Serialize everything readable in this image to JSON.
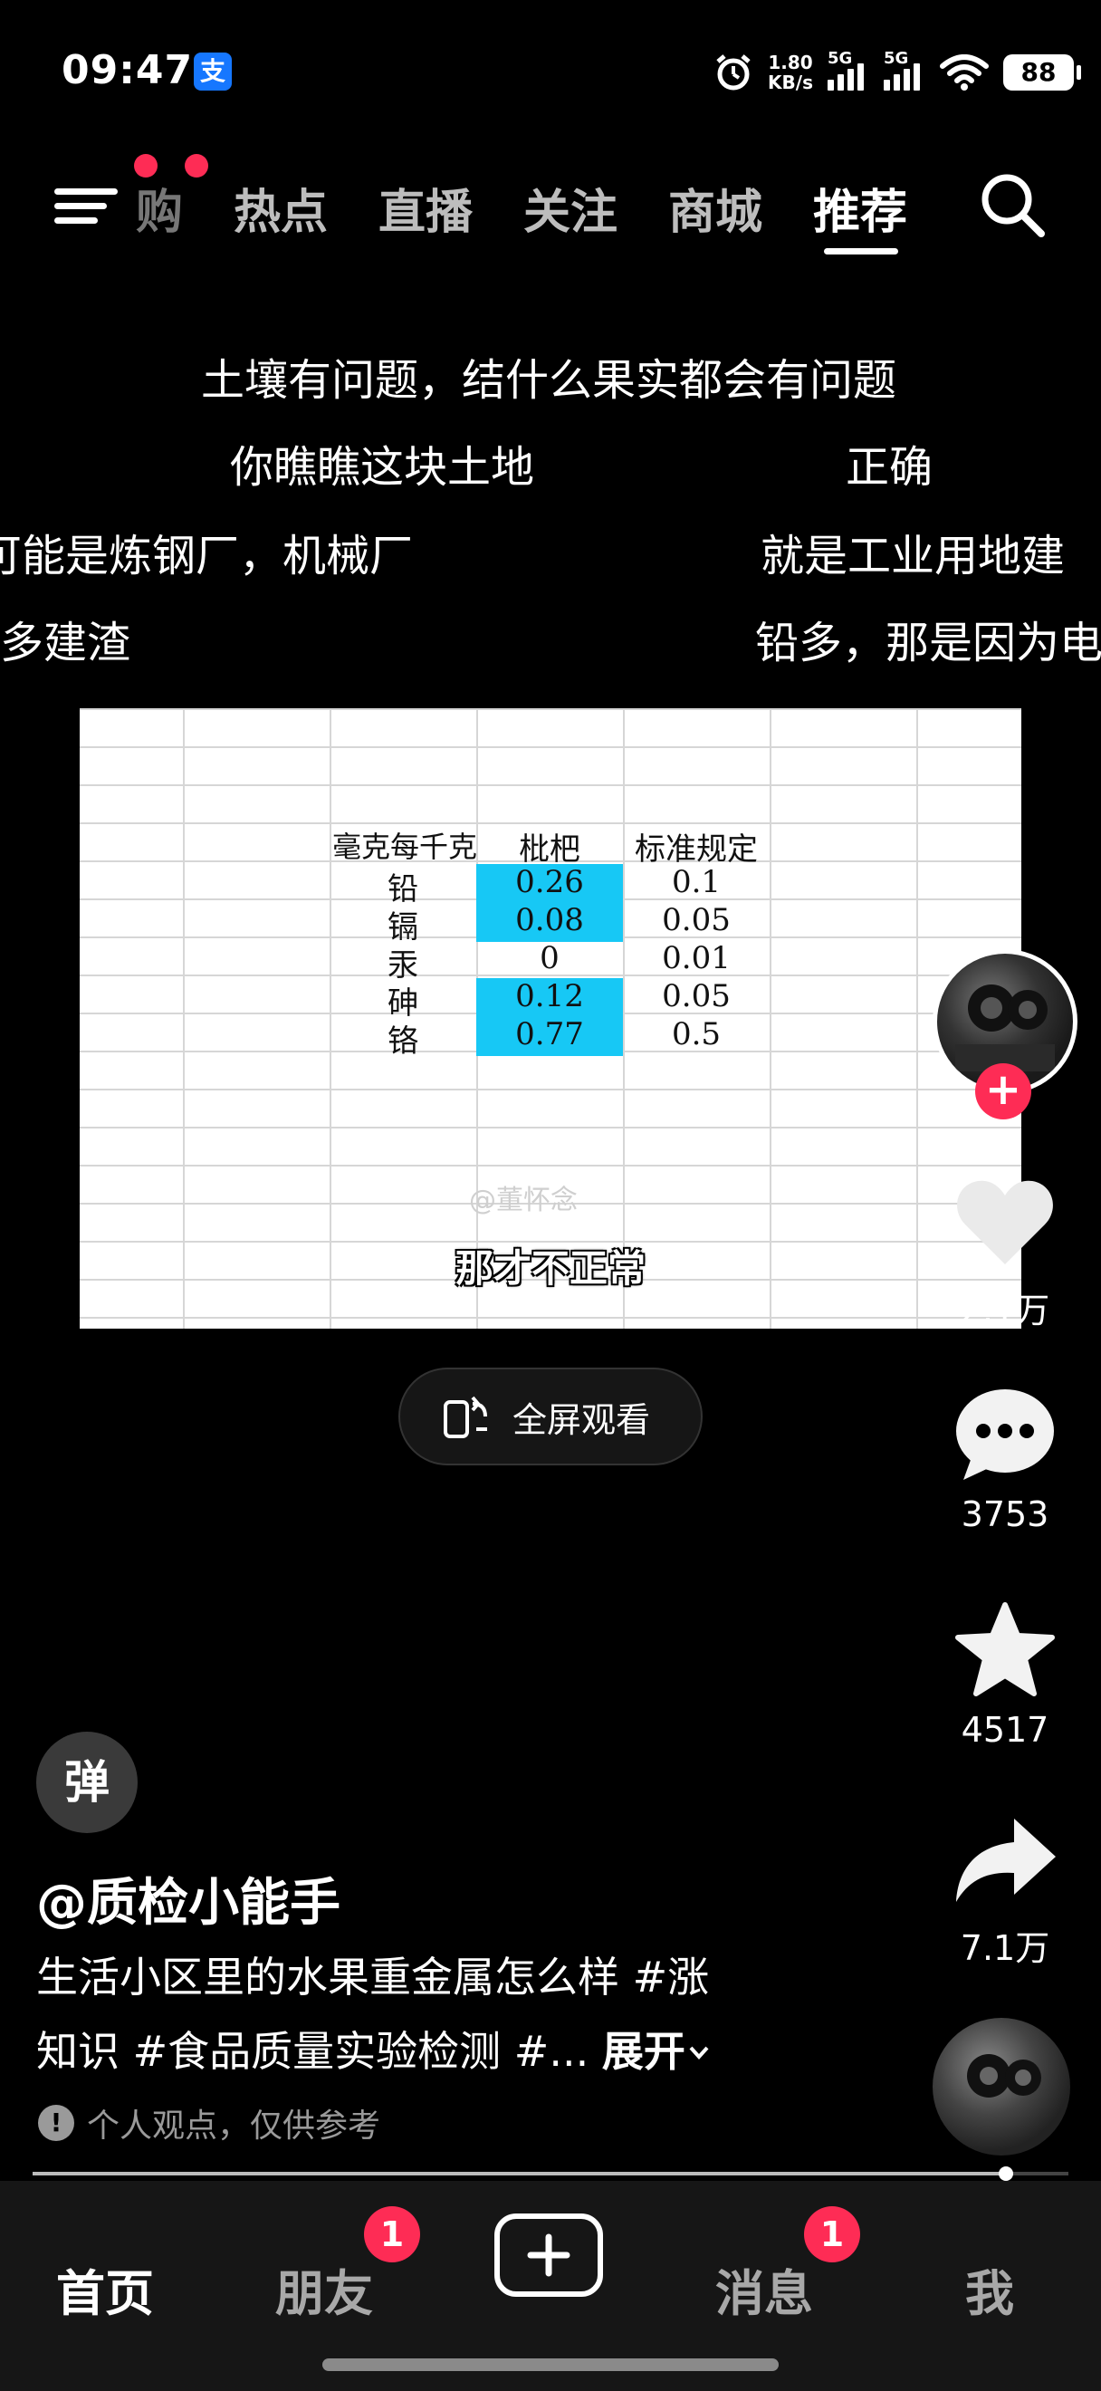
{
  "status_bar": {
    "time": "09:47",
    "app_icon": "alipay-icon",
    "alipay_glyph": "支",
    "net_speed_value": "1.80",
    "net_speed_unit": "KB/s",
    "sim1_label": "5G",
    "sim2_label": "5G",
    "battery": "88"
  },
  "top_nav": {
    "partial_tab": "购",
    "tabs": [
      "热点",
      "直播",
      "关注",
      "商城",
      "推荐"
    ],
    "active_tab": "推荐"
  },
  "lyrics": [
    "土壤有问题，结什么果实都会有问题",
    "你瞧瞧这块土地",
    "正确",
    "可能是炼钢厂，机械厂",
    "就是工业用地建",
    "很多建渣",
    "铅多，那是因为电"
  ],
  "video": {
    "table_header": [
      "毫克每千克",
      "枇杷",
      "标准规定"
    ],
    "rows": [
      {
        "element": "铅",
        "value": "0.26",
        "standard": "0.1",
        "highlight": true
      },
      {
        "element": "镉",
        "value": "0.08",
        "standard": "0.05",
        "highlight": true
      },
      {
        "element": "汞",
        "value": "0",
        "standard": "0.01",
        "highlight": false
      },
      {
        "element": "砷",
        "value": "0.12",
        "standard": "0.05",
        "highlight": true
      },
      {
        "element": "铬",
        "value": "0.77",
        "standard": "0.5",
        "highlight": true
      }
    ],
    "watermark": "@董怀念",
    "subtitle": "那才不正常",
    "highlight_color": "#17c8f5"
  },
  "fullscreen_button": {
    "label": "全屏观看"
  },
  "right_rail": {
    "like_count": "2.1万",
    "comment_count": "3753",
    "favorite_count": "4517",
    "share_count": "7.1万"
  },
  "post": {
    "effect_badge": "弹",
    "author": "@质检小能手",
    "desc_line1": "生活小区里的水果重金属怎么样 #涨",
    "desc_line2": "知识 #食品质量实验检测 #...",
    "expand_label": "展开",
    "disclaimer": "个人观点，仅供参考"
  },
  "playback": {
    "progress": 0.94
  },
  "tab_bar": {
    "home": "首页",
    "friends": "朋友",
    "friends_badge": "1",
    "messages": "消息",
    "messages_badge": "1",
    "me": "我"
  },
  "colors": {
    "accent": "#fe2c55",
    "background": "#000000"
  }
}
